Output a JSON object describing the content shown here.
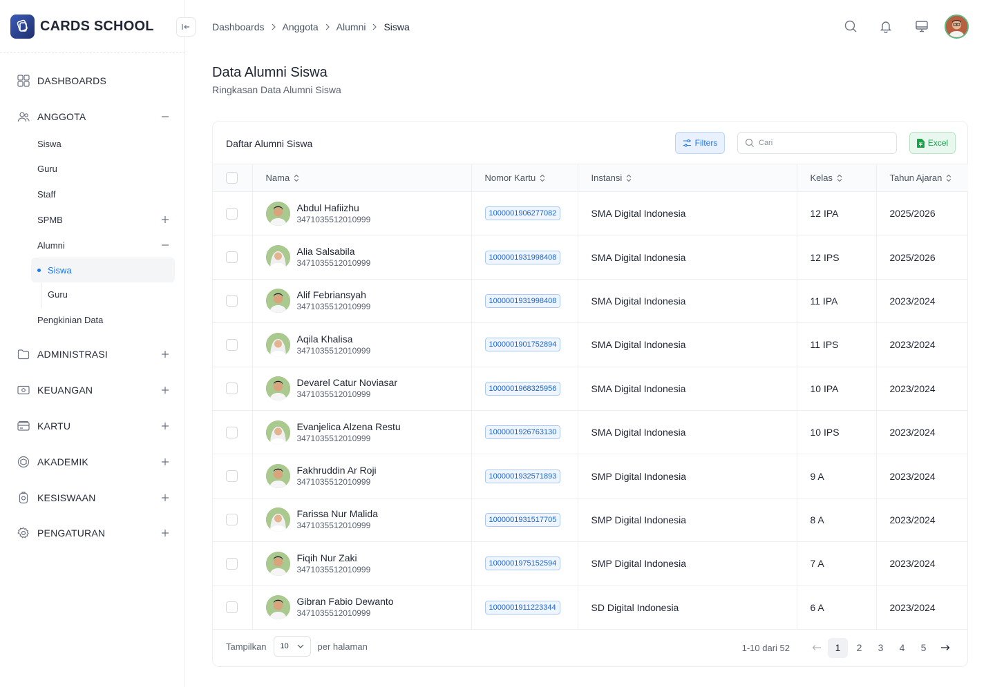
{
  "brand": {
    "name": "CARDS SCHOOL"
  },
  "sidebar": {
    "top_items": [
      {
        "label": "DASHBOARDS",
        "icon": "grid-icon"
      },
      {
        "label": "ANGGOTA",
        "icon": "users-icon"
      },
      {
        "label": "ADMINISTRASI",
        "icon": "folder-icon"
      },
      {
        "label": "KEUANGAN",
        "icon": "money-icon"
      },
      {
        "label": "KARTU",
        "icon": "card-icon"
      },
      {
        "label": "AKADEMIK",
        "icon": "book-icon"
      },
      {
        "label": "KESISWAAN",
        "icon": "badge-icon"
      },
      {
        "label": "PENGATURAN",
        "icon": "gear-icon"
      }
    ],
    "anggota_sub": [
      "Siswa",
      "Guru",
      "Staff",
      "SPMB",
      "Alumni",
      "Pengkinian Data"
    ],
    "alumni_sub": [
      "Siswa",
      "Guru"
    ]
  },
  "breadcrumb": [
    "Dashboards",
    "Anggota",
    "Alumni",
    "Siswa"
  ],
  "page": {
    "title": "Data Alumni Siswa",
    "subtitle": "Ringkasan Data Alumni Siswa"
  },
  "card": {
    "title": "Daftar Alumni Siswa",
    "filters_label": "Filters",
    "search_placeholder": "Cari",
    "excel_label": "Excel"
  },
  "table": {
    "columns": [
      "Nama",
      "Nomor Kartu",
      "Instansi",
      "Kelas",
      "Tahun Ajaran"
    ],
    "rows": [
      {
        "name": "Abdul Hafiizhu",
        "nik": "3471035512010999",
        "card": "1000001906277082",
        "school": "SMA Digital Indonesia",
        "kelas": "12 IPA",
        "tahun": "2025/2026",
        "g": "m"
      },
      {
        "name": "Alia Salsabila",
        "nik": "3471035512010999",
        "card": "1000001931998408",
        "school": "SMA Digital Indonesia",
        "kelas": "12 IPS",
        "tahun": "2025/2026",
        "g": "f"
      },
      {
        "name": "Alif Febriansyah",
        "nik": "3471035512010999",
        "card": "1000001931998408",
        "school": "SMA Digital Indonesia",
        "kelas": "11 IPA",
        "tahun": "2023/2024",
        "g": "m"
      },
      {
        "name": "Aqila Khalisa",
        "nik": "3471035512010999",
        "card": "1000001901752894",
        "school": "SMA Digital Indonesia",
        "kelas": "11 IPS",
        "tahun": "2023/2024",
        "g": "f"
      },
      {
        "name": "Devarel Catur Noviasar",
        "nik": "3471035512010999",
        "card": "1000001968325956",
        "school": "SMA Digital Indonesia",
        "kelas": "10 IPA",
        "tahun": "2023/2024",
        "g": "m"
      },
      {
        "name": "Evanjelica Alzena Restu",
        "nik": "3471035512010999",
        "card": "1000001926763130",
        "school": "SMA Digital Indonesia",
        "kelas": "10 IPS",
        "tahun": "2023/2024",
        "g": "f"
      },
      {
        "name": "Fakhruddin Ar Roji",
        "nik": "3471035512010999",
        "card": "1000001932571893",
        "school": "SMP Digital Indonesia",
        "kelas": "9 A",
        "tahun": "2023/2024",
        "g": "m"
      },
      {
        "name": "Farissa Nur Malida",
        "nik": "3471035512010999",
        "card": "1000001931517705",
        "school": "SMP Digital Indonesia",
        "kelas": "8 A",
        "tahun": "2023/2024",
        "g": "f"
      },
      {
        "name": "Fiqih Nur Zaki",
        "nik": "3471035512010999",
        "card": "1000001975152594",
        "school": "SMP Digital Indonesia",
        "kelas": "7 A",
        "tahun": "2023/2024",
        "g": "m"
      },
      {
        "name": "Gibran Fabio Dewanto",
        "nik": "3471035512010999",
        "card": "1000001911223344",
        "school": "SD Digital Indonesia",
        "kelas": "6 A",
        "tahun": "2023/2024",
        "g": "m"
      }
    ]
  },
  "footer": {
    "show_label": "Tampilkan",
    "per_page_value": "10",
    "per_page_label": "per halaman",
    "range": "1-10 dari 52",
    "pages": [
      "1",
      "2",
      "3",
      "4",
      "5"
    ],
    "current_page": "1"
  },
  "colors": {
    "accent": "#1877f2",
    "excel": "#16a34a"
  }
}
